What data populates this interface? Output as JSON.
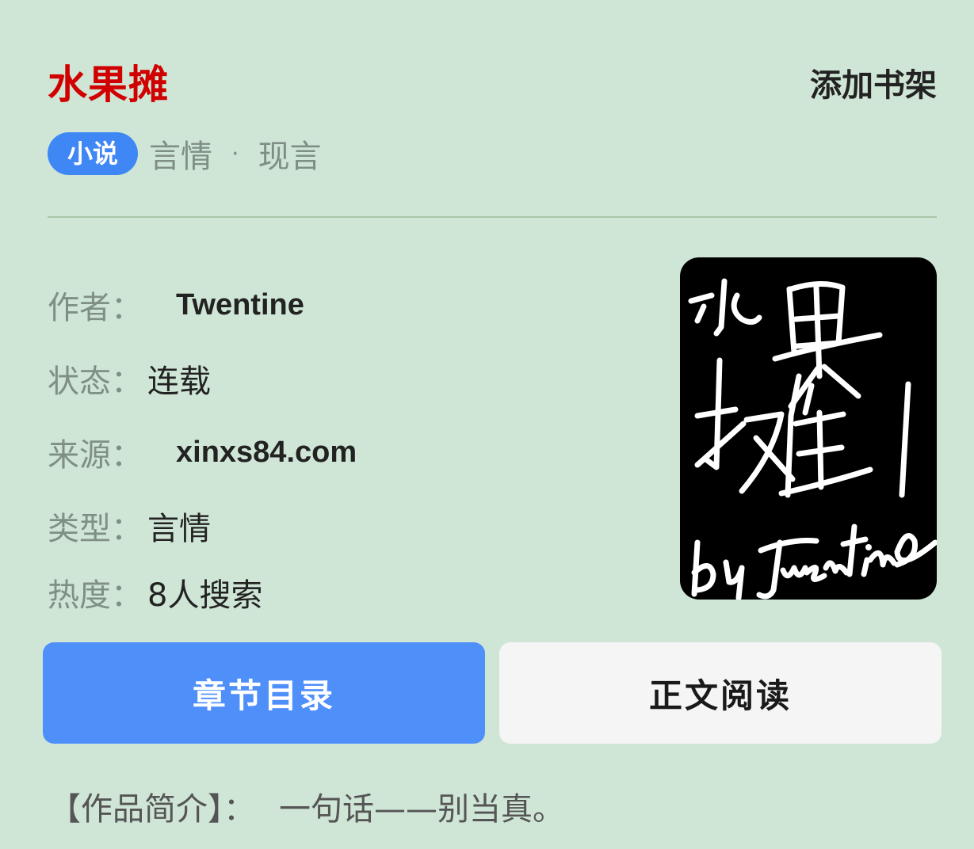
{
  "header": {
    "title": "水果摊",
    "add_shelf_label": "添加书架"
  },
  "tags": {
    "category": "小说",
    "genre": "言情",
    "separator": "·",
    "subgenre": "现言"
  },
  "info": {
    "author": {
      "label": "作者：",
      "value": "Twentine"
    },
    "status": {
      "label": "状态：",
      "value": "连载"
    },
    "source": {
      "label": "来源：",
      "value": "xinxs84.com"
    },
    "type": {
      "label": "类型：",
      "value": "言情"
    },
    "popularity": {
      "label": "热度：",
      "value": "8人搜索"
    }
  },
  "cover": {
    "text": "水果摊 by Twentine"
  },
  "buttons": {
    "catalog_label": "章节目录",
    "read_label": "正文阅读"
  },
  "intro": {
    "label": "【作品简介】：",
    "text": "一句话——别当真。"
  },
  "colors": {
    "background": "#cfe6d6",
    "title_red": "#d10000",
    "accent_blue": "#4f8ffa",
    "tag_blue": "#3f87f5"
  }
}
